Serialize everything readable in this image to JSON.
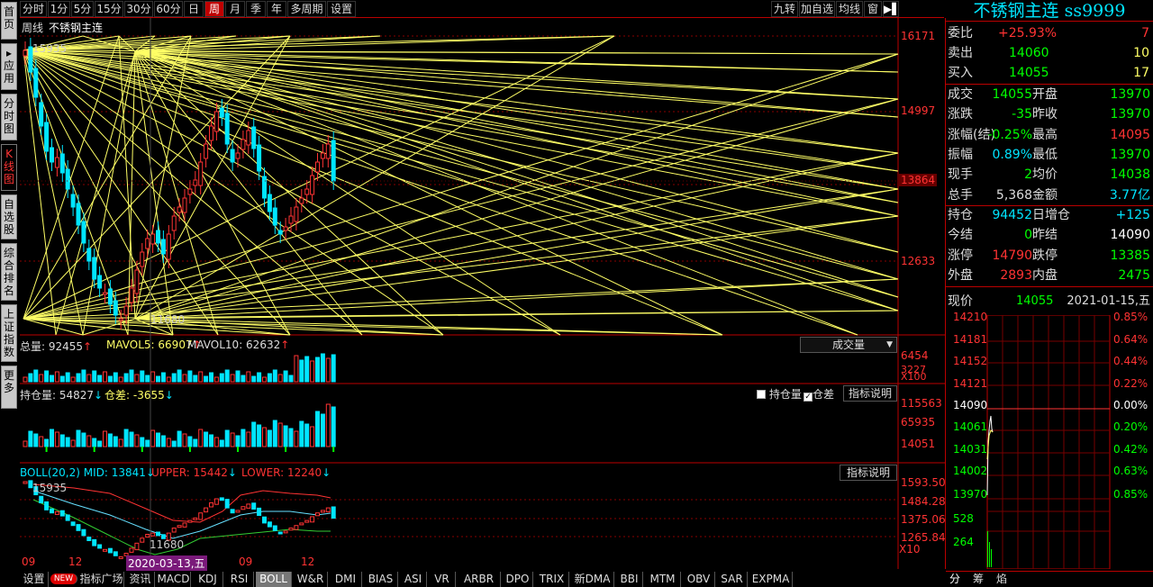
{
  "side_tabs": [
    "首页",
    "应用",
    "分时图",
    "K线图",
    "自选股",
    "综合排名",
    "上证指数",
    "更多"
  ],
  "toolbar": {
    "periods": [
      "分时",
      "1分",
      "5分",
      "15分",
      "30分",
      "60分",
      "日",
      "周",
      "月",
      "季",
      "年",
      "多周期",
      "设置"
    ],
    "active_period": "周",
    "right_buttons": [
      "九转",
      "加自选",
      "均线",
      "窗"
    ]
  },
  "chart": {
    "period_label": "周线",
    "instrument": "不锈钢主连",
    "price_axis": [
      "16171",
      "14997",
      "13864",
      "12633"
    ],
    "high_mark": "15935",
    "low_mark": "11680",
    "volume": {
      "header": [
        "总量: 92455",
        "MAVOL5: 66907",
        "MAVOL10: 62632"
      ],
      "dropdown": "成交量",
      "axis": [
        "6454",
        "3227",
        "X100"
      ]
    },
    "open_interest": {
      "header": [
        "持仓量: 54827",
        "仓差: -3655"
      ],
      "checkbox_oi": "持仓量",
      "checkbox_diff": "仓差",
      "explain": "指标说明",
      "axis": [
        "115563",
        "65935",
        "14051"
      ]
    },
    "boll": {
      "header": [
        "BOLL(20,2) MID: 13841",
        "UPPER: 15442",
        "LOWER: 12240"
      ],
      "explain": "指标说明",
      "axis": [
        "1593.50",
        "1484.28",
        "1375.06",
        "1265.84",
        "X10"
      ],
      "high_mark": "15935",
      "low_mark": "11680"
    },
    "time_axis": [
      "09",
      "12",
      "09",
      "12"
    ],
    "cursor_date": "2020-03-13,五"
  },
  "quote": {
    "title": "不锈钢主连 ss9999",
    "rows1": [
      {
        "label": "委比",
        "value": "+25.93%",
        "extra": "7",
        "color": "#ff3333"
      },
      {
        "label": "卖出",
        "value": "14060",
        "extra": "10",
        "color": "#00ff00"
      },
      {
        "label": "买入",
        "value": "14055",
        "extra": "17",
        "color": "#00ff00"
      }
    ],
    "rows2": [
      {
        "l1": "成交",
        "v1": "14055",
        "c1": "#00ff00",
        "l2": "开盘",
        "v2": "13970",
        "c2": "#00ff00"
      },
      {
        "l1": "涨跌",
        "v1": "-35",
        "c1": "#00ff00",
        "l2": "昨收",
        "v2": "13970",
        "c2": "#00ff00"
      },
      {
        "l1": "涨幅(结)",
        "v1": "-0.25%",
        "c1": "#00ff00",
        "l2": "最高",
        "v2": "14095",
        "c2": "#ff3333"
      },
      {
        "l1": "振幅",
        "v1": "0.89%",
        "c1": "#00e5ff",
        "l2": "最低",
        "v2": "13970",
        "c2": "#00ff00"
      },
      {
        "l1": "现手",
        "v1": "2",
        "c1": "#00ff00",
        "l2": "均价",
        "v2": "14038",
        "c2": "#00ff00"
      },
      {
        "l1": "总手",
        "v1": "5,368",
        "c1": "#dddddd",
        "l2": "金额",
        "v2": "3.77亿",
        "c2": "#00e5ff"
      }
    ],
    "rows3": [
      {
        "l1": "持仓",
        "v1": "94452",
        "c1": "#00e5ff",
        "l2": "日增仓",
        "v2": "+125",
        "c2": "#00e5ff"
      },
      {
        "l1": "今结",
        "v1": "0",
        "c1": "#00ff00",
        "l2": "昨结",
        "v2": "14090",
        "c2": "#ffffff"
      },
      {
        "l1": "涨停",
        "v1": "14790",
        "c1": "#ff3333",
        "l2": "跌停",
        "v2": "13385",
        "c2": "#00ff00"
      },
      {
        "l1": "外盘",
        "v1": "2893",
        "c1": "#ff3333",
        "l2": "内盘",
        "v2": "2475",
        "c2": "#00ff00"
      }
    ],
    "now_label": "现价",
    "now_value": "14055",
    "now_date": "2021-01-15,五"
  },
  "mini_chart": {
    "left_axis": [
      "14210",
      "14181",
      "14152",
      "14121",
      "14090",
      "14061",
      "14031",
      "14002",
      "13970",
      "528",
      "264"
    ],
    "right_axis": [
      "0.85%",
      "0.64%",
      "0.44%",
      "0.22%",
      "0.00%",
      "0.20%",
      "0.42%",
      "0.63%",
      "0.85%"
    ],
    "tabs": [
      "分",
      "筹",
      "焰"
    ]
  },
  "bottom_tabs": [
    "设置",
    "NEW",
    "指标广场",
    "资讯",
    "MACD",
    "KDJ",
    "RSI",
    "BOLL",
    "W&R",
    "DMI",
    "BIAS",
    "ASI",
    "VR",
    "ARBR",
    "DPO",
    "TRIX",
    "新DMA",
    "BBI",
    "MTM",
    "OBV",
    "SAR",
    "EXPMA"
  ],
  "active_bottom_tab": "BOLL",
  "colors": {
    "up": "#ff3333",
    "down": "#00e5ff",
    "frame": "#bb0000",
    "gann": "#ffff66"
  }
}
